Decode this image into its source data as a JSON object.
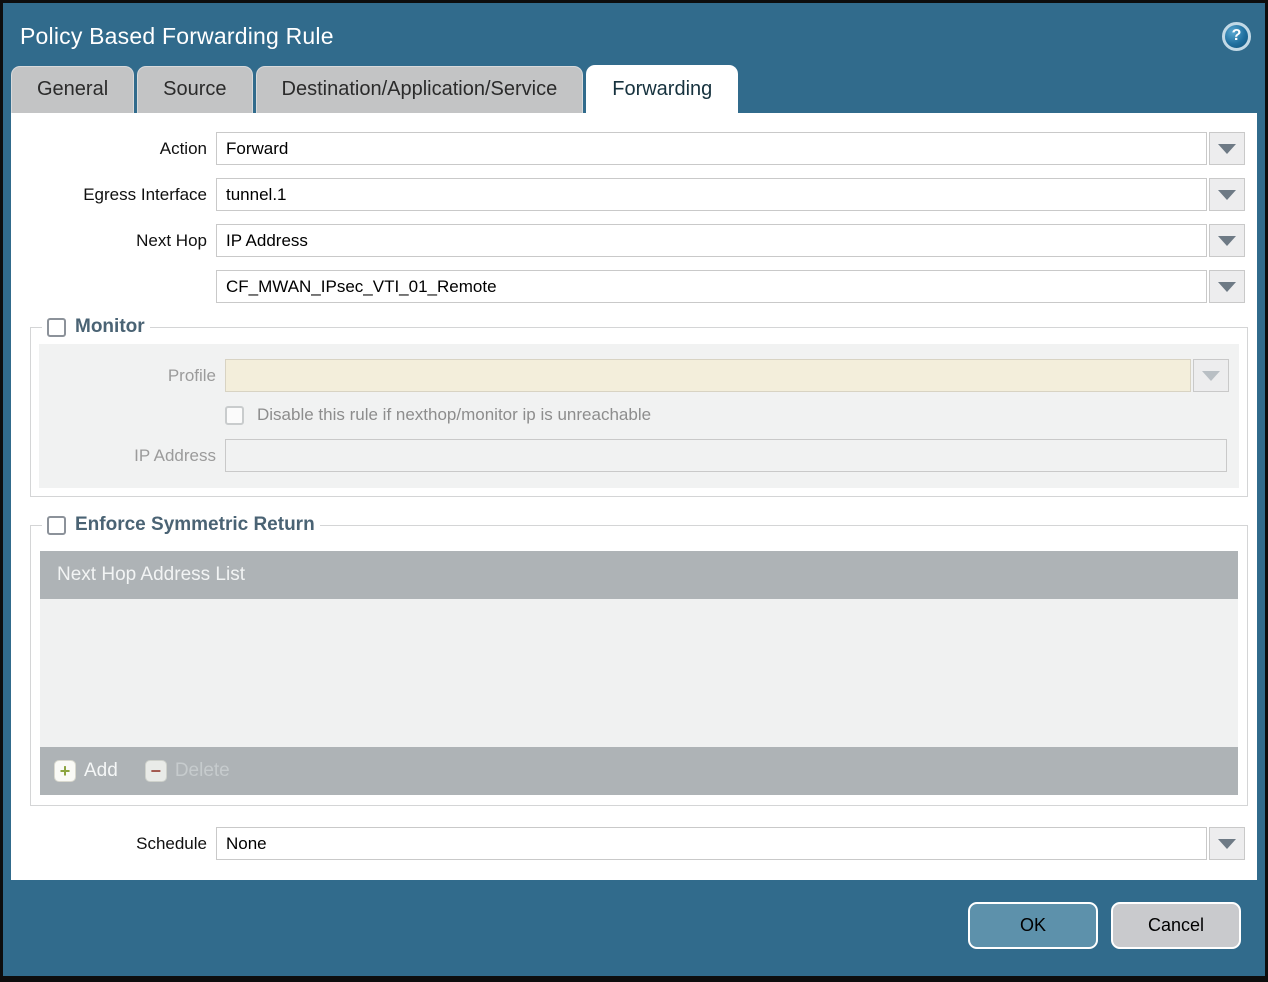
{
  "dialog": {
    "title": "Policy Based Forwarding Rule",
    "help_glyph": "?"
  },
  "tabs": [
    {
      "label": "General",
      "active": false
    },
    {
      "label": "Source",
      "active": false
    },
    {
      "label": "Destination/Application/Service",
      "active": false
    },
    {
      "label": "Forwarding",
      "active": true
    }
  ],
  "form": {
    "action": {
      "label": "Action",
      "value": "Forward"
    },
    "egress_interface": {
      "label": "Egress Interface",
      "value": "tunnel.1"
    },
    "next_hop": {
      "label": "Next Hop",
      "value": "IP Address"
    },
    "next_hop_address": {
      "value": "CF_MWAN_IPsec_VTI_01_Remote"
    },
    "schedule": {
      "label": "Schedule",
      "value": "None"
    }
  },
  "monitor": {
    "legend": "Monitor",
    "checked": false,
    "profile": {
      "label": "Profile",
      "value": ""
    },
    "disable_rule_label": "Disable this rule if nexthop/monitor ip is unreachable",
    "disable_rule_checked": false,
    "ip_address": {
      "label": "IP Address",
      "value": ""
    }
  },
  "symmetric_return": {
    "legend": "Enforce Symmetric Return",
    "checked": false,
    "table_header": "Next Hop Address List",
    "rows": [],
    "add_label": "Add",
    "delete_label": "Delete",
    "add_glyph": "+",
    "delete_glyph": "−"
  },
  "footer": {
    "ok_label": "OK",
    "cancel_label": "Cancel"
  },
  "colors": {
    "chrome": "#316b8c",
    "ok_button": "#5d91ab",
    "cancel_button": "#c9cacd",
    "table_header_bar": "#aeb3b6",
    "required_field_cream": "#f3eedb",
    "legend_text": "#4a6374"
  }
}
